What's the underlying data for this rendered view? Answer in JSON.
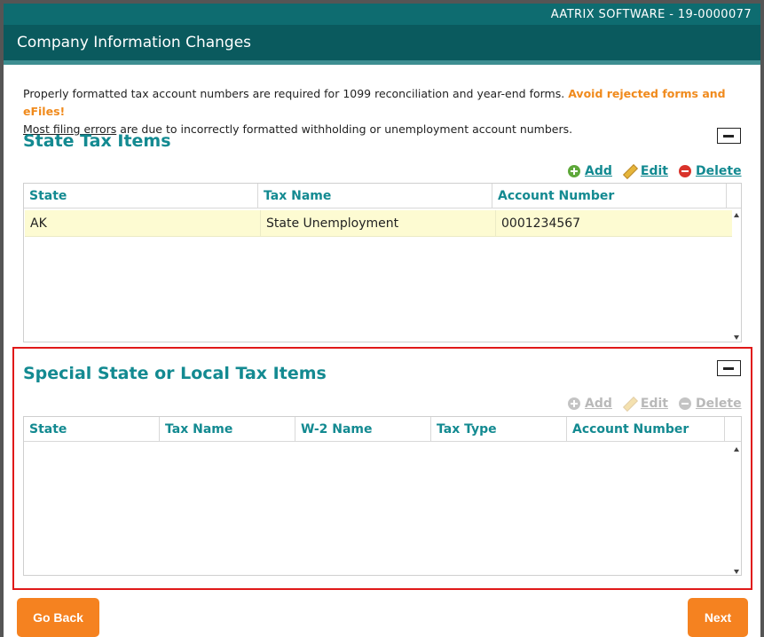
{
  "window": {
    "company_id": "AATRIX SOFTWARE - 19-0000077",
    "title": "Company Information Changes"
  },
  "notice": {
    "line1": "Properly formatted tax account numbers are required for 1099 reconciliation and year-end forms.",
    "warning": "Avoid rejected forms and eFiles!",
    "link": "Most filing errors",
    "line2": "are due to incorrectly formatted withholding or unemployment account numbers."
  },
  "state_tax": {
    "title": "State Tax Items",
    "actions": {
      "add": "Add",
      "edit": "Edit",
      "delete": "Delete"
    },
    "columns": [
      "State",
      "Tax Name",
      "Account Number"
    ],
    "rows": [
      {
        "state": "AK",
        "tax_name": "State Unemployment",
        "account_number": "0001234567"
      }
    ]
  },
  "special_tax": {
    "title": "Special State or Local Tax Items",
    "actions": {
      "add": "Add",
      "edit": "Edit",
      "delete": "Delete"
    },
    "columns": [
      "State",
      "Tax Name",
      "W-2 Name",
      "Tax Type",
      "Account Number"
    ],
    "rows": []
  },
  "footer": {
    "back": "Go Back",
    "next": "Next"
  },
  "colors": {
    "header_bg": "#0a5a5e",
    "accent_teal": "#138a91",
    "warning_orange": "#f08a1c",
    "button_orange": "#f58220",
    "add_green": "#5ea83a",
    "delete_red": "#d9332b",
    "highlight_red": "#e01919",
    "row_selected": "#fdfbd2"
  }
}
